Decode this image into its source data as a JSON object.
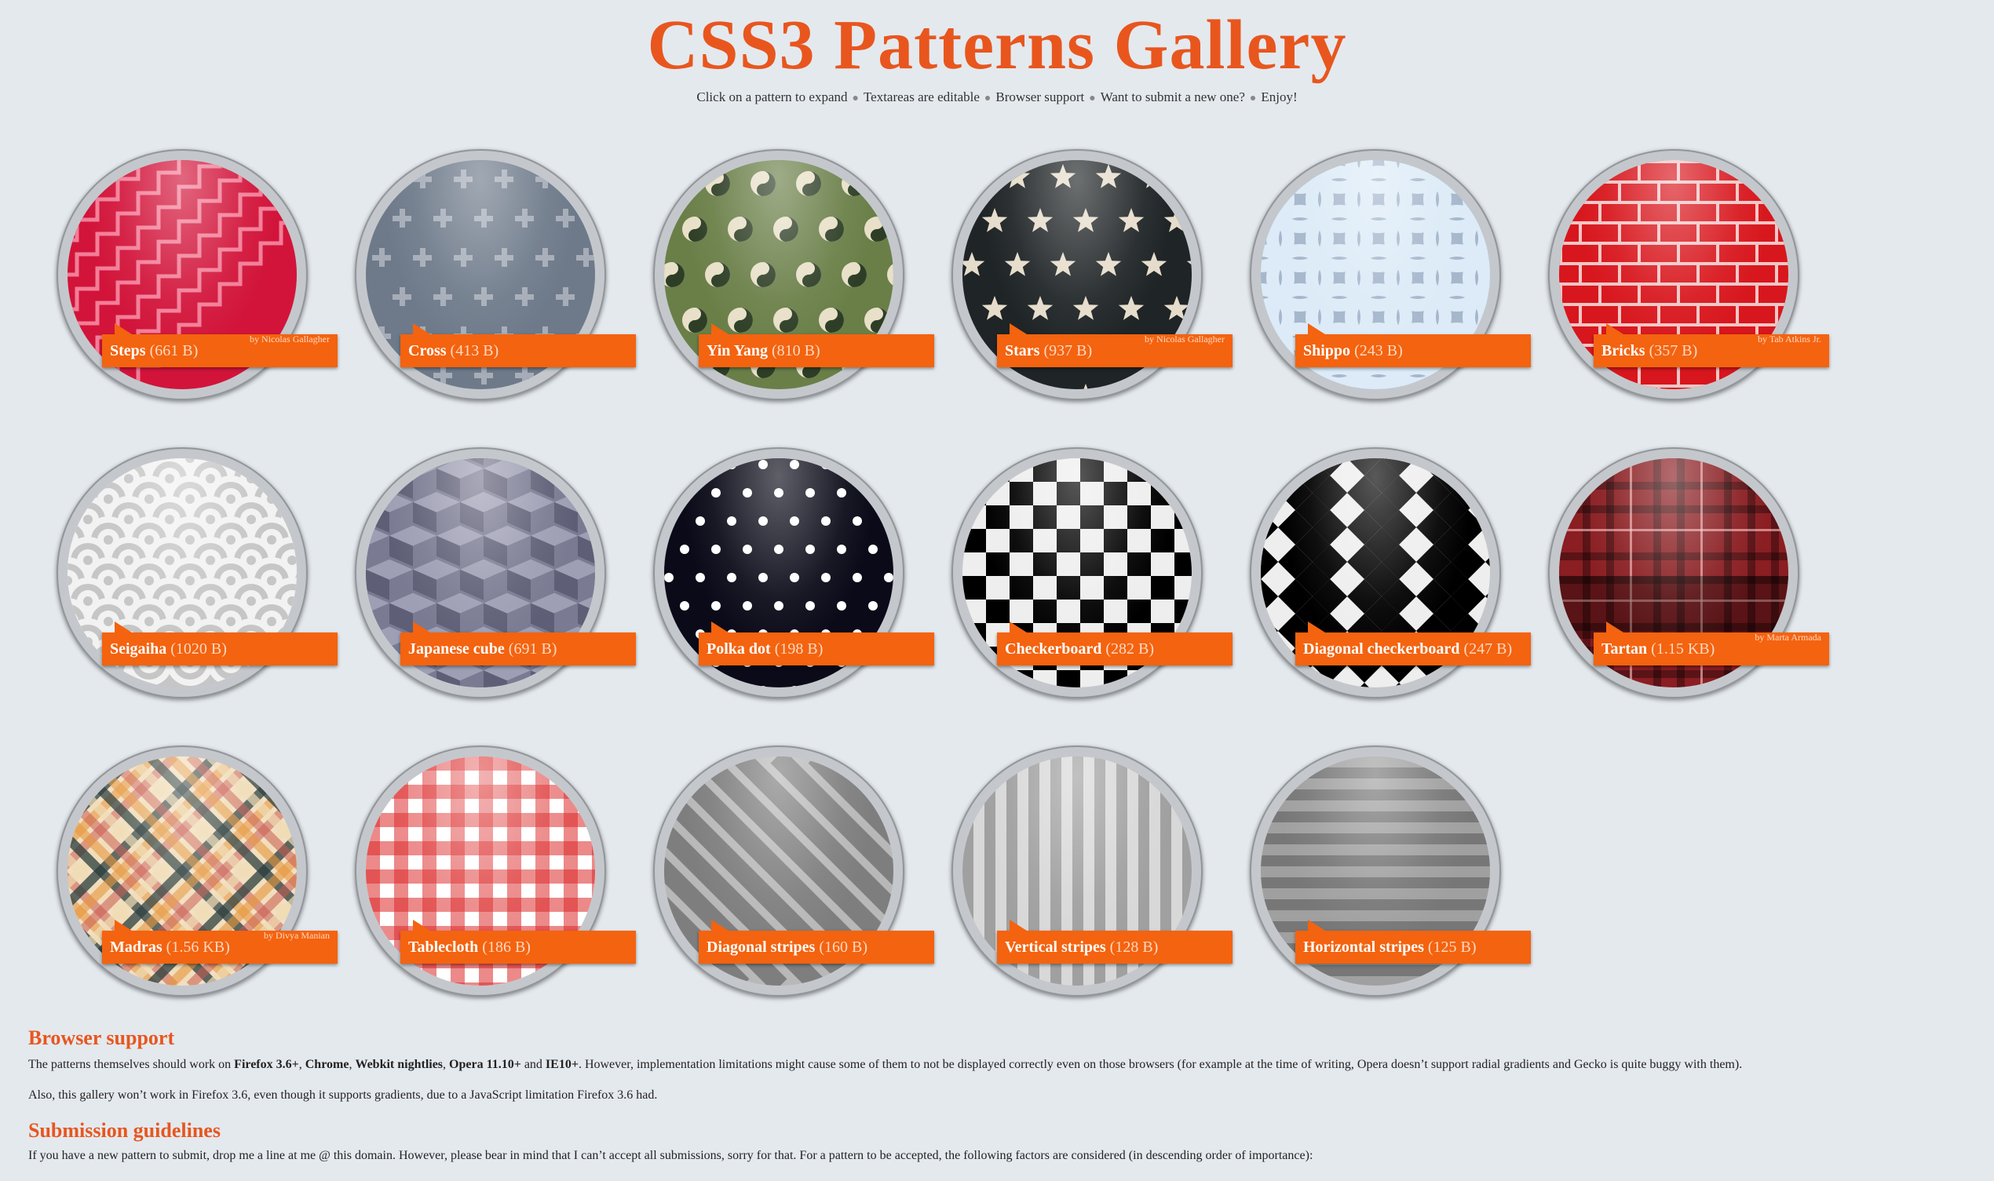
{
  "header": {
    "title": "CSS3 Patterns Gallery",
    "nav": [
      "Click on a pattern to expand",
      "Textareas are editable",
      "Browser support",
      "Want to submit a new one?",
      "Enjoy!"
    ],
    "separator": "●"
  },
  "colors": {
    "accent": "#f4630f",
    "title": "#e8561e",
    "background": "#e4e9ee"
  },
  "patterns": [
    {
      "name": "Steps",
      "size": "(661 B)",
      "author": "by Nicolas Gallagher",
      "style": "steps"
    },
    {
      "name": "Cross",
      "size": "(413 B)",
      "author": "",
      "style": "cross"
    },
    {
      "name": "Yin Yang",
      "size": "(810 B)",
      "author": "",
      "style": "yinyang"
    },
    {
      "name": "Stars",
      "size": "(937 B)",
      "author": "by Nicolas Gallagher",
      "style": "stars"
    },
    {
      "name": "Shippo",
      "size": "(243 B)",
      "author": "",
      "style": "shippo"
    },
    {
      "name": "Bricks",
      "size": "(357 B)",
      "author": "by Tab Atkins Jr.",
      "style": "bricks"
    },
    {
      "name": "Seigaiha",
      "size": "(1020 B)",
      "author": "",
      "style": "seigaiha"
    },
    {
      "name": "Japanese cube",
      "size": "(691 B)",
      "author": "",
      "style": "cube"
    },
    {
      "name": "Polka dot",
      "size": "(198 B)",
      "author": "",
      "style": "polka"
    },
    {
      "name": "Checkerboard",
      "size": "(282 B)",
      "author": "",
      "style": "checker"
    },
    {
      "name": "Diagonal checkerboard",
      "size": "(247 B)",
      "author": "",
      "style": "diagchecker"
    },
    {
      "name": "Tartan",
      "size": "(1.15 KB)",
      "author": "by Marta Armada",
      "style": "tartan"
    },
    {
      "name": "Madras",
      "size": "(1.56 KB)",
      "author": "by Divya Manian",
      "style": "madras"
    },
    {
      "name": "Tablecloth",
      "size": "(186 B)",
      "author": "",
      "style": "tablecloth"
    },
    {
      "name": "Diagonal stripes",
      "size": "(160 B)",
      "author": "",
      "style": "diagstripes"
    },
    {
      "name": "Vertical stripes",
      "size": "(128 B)",
      "author": "",
      "style": "vstripes"
    },
    {
      "name": "Horizontal stripes",
      "size": "(125 B)",
      "author": "",
      "style": "hstripes"
    }
  ],
  "browser_support": {
    "heading": "Browser support",
    "p1_start": "The patterns themselves should work on ",
    "b1": "Firefox 3.6+",
    "t1": ", ",
    "b2": "Chrome",
    "t2": ", ",
    "b3": "Webkit nightlies",
    "t3": ", ",
    "b4": "Opera 11.10+",
    "t4": " and ",
    "b5": "IE10+",
    "p1_end": ". However, implementation limitations might cause some of them to not be displayed correctly even on those browsers (for example at the time of writing, Opera doesn’t support radial gradients and Gecko is quite buggy with them).",
    "p2": "Also, this gallery won’t work in Firefox 3.6, even though it supports gradients, due to a JavaScript limitation Firefox 3.6 had."
  },
  "submission": {
    "heading": "Submission guidelines",
    "p1": "If you have a new pattern to submit, drop me a line at me @ this domain. However, please bear in mind that I can’t accept all submissions, sorry for that. For a pattern to be accepted, the following factors are considered (in descending order of importance):"
  }
}
